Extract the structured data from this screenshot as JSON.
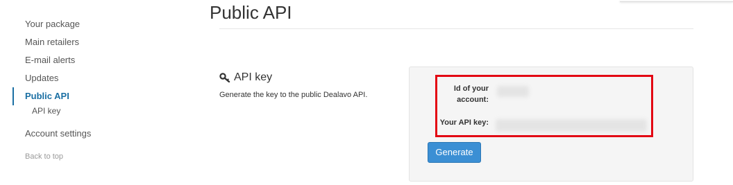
{
  "sidebar": {
    "items": [
      {
        "label": "Your package"
      },
      {
        "label": "Main retailers"
      },
      {
        "label": "E-mail alerts"
      },
      {
        "label": "Updates"
      },
      {
        "label": "Public API",
        "active": true
      },
      {
        "label": "Account settings"
      }
    ],
    "subitems": [
      {
        "label": "API key"
      }
    ],
    "back_to_top": "Back to top"
  },
  "main": {
    "title": "Public API",
    "section": {
      "icon": "key-icon",
      "heading": "API key",
      "description": "Generate the key to the public Dealavo API."
    },
    "panel": {
      "account_id_label": "Id of your account:",
      "api_key_label": "Your API key:",
      "generate_label": "Generate"
    }
  },
  "colors": {
    "active_nav": "#1a6fa3",
    "highlight_border": "#e30613",
    "button_bg": "#3b8fd4",
    "panel_bg": "#f5f5f5"
  }
}
